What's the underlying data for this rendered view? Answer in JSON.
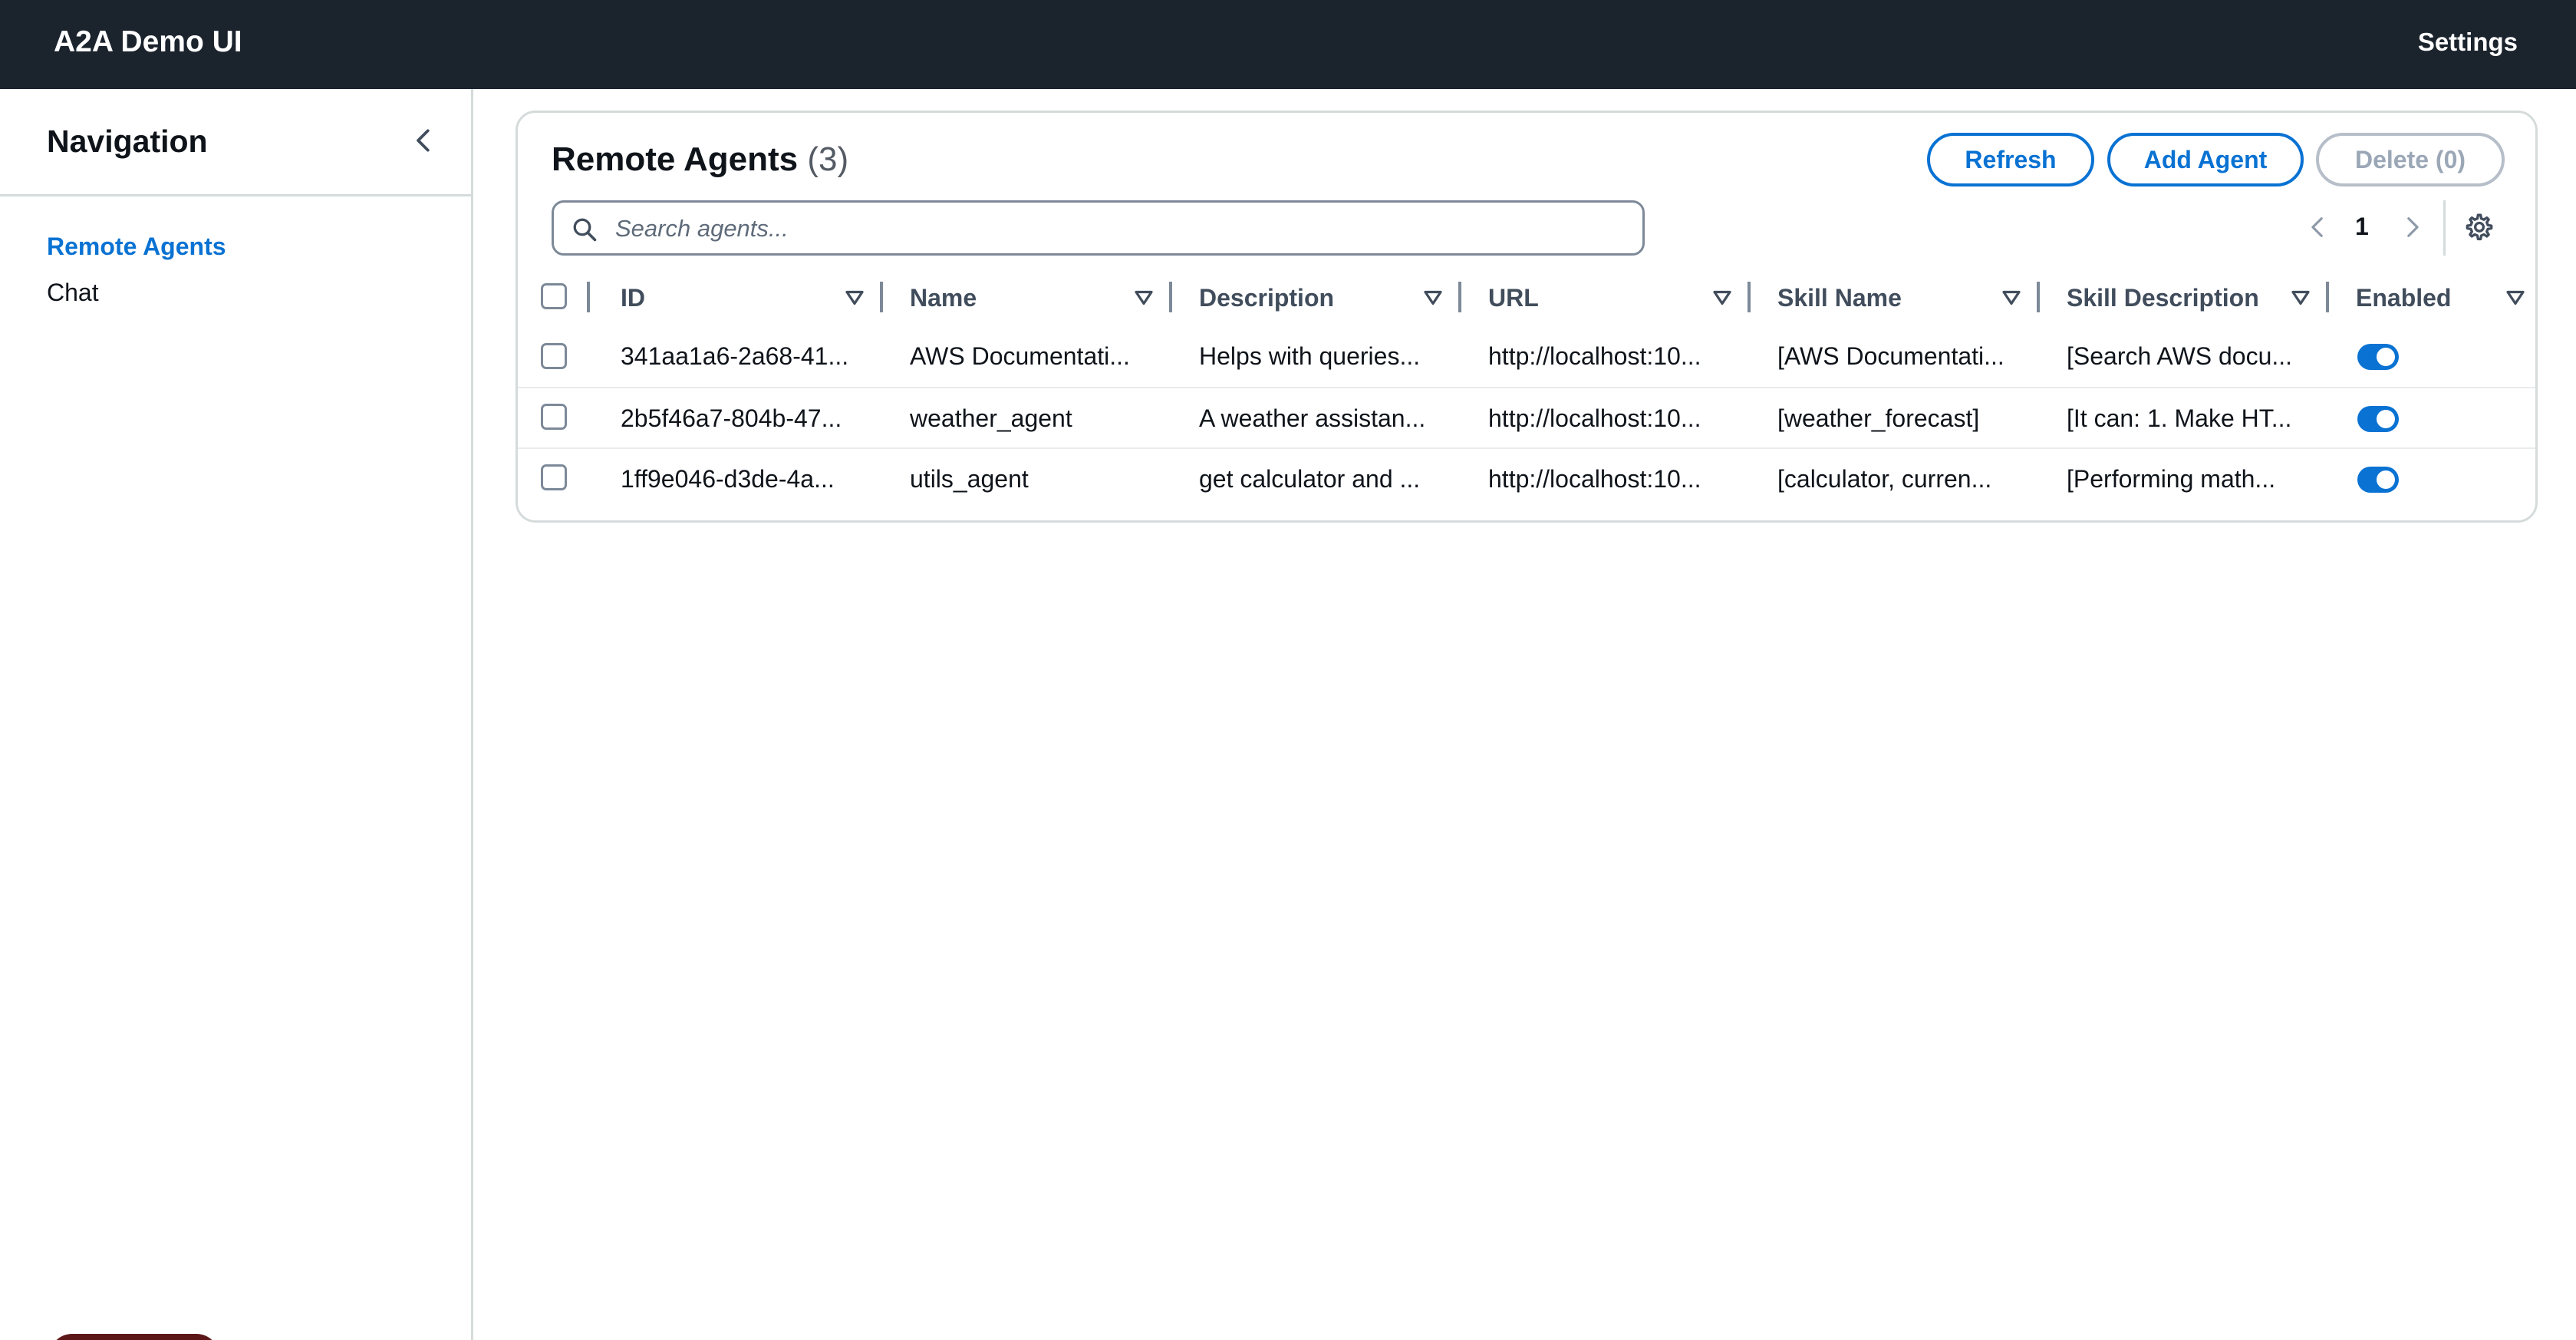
{
  "app": {
    "title": "A2A Demo UI",
    "settings_label": "Settings"
  },
  "sidebar": {
    "title": "Navigation",
    "items": [
      {
        "label": "Remote Agents",
        "active": true
      },
      {
        "label": "Chat",
        "active": false
      }
    ]
  },
  "panel": {
    "title": "Remote Agents",
    "count": "(3)",
    "buttons": {
      "refresh": "Refresh",
      "add": "Add Agent",
      "delete": "Delete (0)"
    },
    "search": {
      "placeholder": "Search agents...",
      "value": ""
    },
    "pagination": {
      "current_page": "1"
    }
  },
  "table": {
    "columns": [
      "ID",
      "Name",
      "Description",
      "URL",
      "Skill Name",
      "Skill Description",
      "Enabled"
    ],
    "rows": [
      {
        "id": "341aa1a6-2a68-41...",
        "name": "AWS Documentati...",
        "description": "Helps with queries...",
        "url": "http://localhost:10...",
        "skill_name": "[AWS Documentati...",
        "skill_description": "[Search AWS docu...",
        "enabled": true
      },
      {
        "id": "2b5f46a7-804b-47...",
        "name": "weather_agent",
        "description": "A weather assistan...",
        "url": "http://localhost:10...",
        "skill_name": "[weather_forecast]",
        "skill_description": "[It can: 1. Make HT...",
        "enabled": true
      },
      {
        "id": "1ff9e046-d3de-4a...",
        "name": "utils_agent",
        "description": "get calculator and ...",
        "url": "http://localhost:10...",
        "skill_name": "[calculator, curren...",
        "skill_description": "[Performing math...",
        "enabled": true
      }
    ]
  },
  "icons": {
    "collapse": "chevron-left-icon",
    "search": "search-icon",
    "prev": "chevron-left-icon",
    "next": "chevron-right-icon",
    "preferences": "gear-icon",
    "sort": "caret-down-icon"
  },
  "colors": {
    "topbar": "#1b232d",
    "accent": "#0972d3",
    "disabled": "#9ba7b6",
    "border": "#d5dbdb"
  }
}
